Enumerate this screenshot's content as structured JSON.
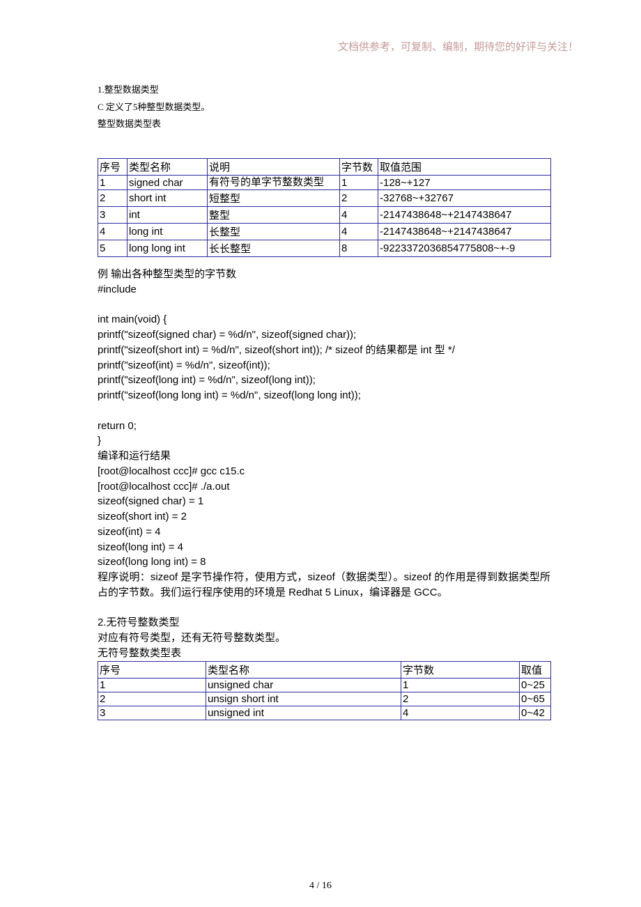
{
  "header_note": "文档供参考，可复制、编制，期待您的好评与关注！",
  "intro": {
    "l1": "1.整型数据类型",
    "l2": "C 定义了5种整型数据类型。",
    "l3": "整型数据类型表"
  },
  "table1": {
    "headers": [
      "序号",
      "类型名称",
      "说明",
      "字节数",
      "取值范围"
    ],
    "rows": [
      [
        "1",
        "signed char",
        "有符号的单字节整数类型",
        "1",
        "-128~+127"
      ],
      [
        "2",
        "short int",
        "短整型",
        "2",
        "-32768~+32767"
      ],
      [
        "3",
        "int",
        "整型",
        "4",
        "-2147438648~+2147438647"
      ],
      [
        "4",
        "long int",
        "长整型",
        "4",
        "-2147438648~+2147438647"
      ],
      [
        "5",
        "long long int",
        "长长整型",
        "8",
        "-9223372036854775808~+-9"
      ]
    ]
  },
  "code": {
    "l0": "例  输出各种整型类型的字节数",
    "l1": "#include",
    "l2": "int main(void) {",
    "l3": "printf(\"sizeof(signed char) = %d/n\", sizeof(signed char));",
    "l4": "printf(\"sizeof(short int) = %d/n\", sizeof(short int)); /* sizeof 的结果都是 int 型  */",
    "l5": "printf(\"sizeof(int) = %d/n\", sizeof(int));",
    "l6": "printf(\"sizeof(long int) = %d/n\", sizeof(long int));",
    "l7": "printf(\"sizeof(long long int) = %d/n\", sizeof(long long int));",
    "l8": "return 0;",
    "l9": "}",
    "r0": "编译和运行结果",
    "r1": "[root@localhost ccc]# gcc c15.c",
    "r2": "[root@localhost ccc]# ./a.out",
    "r3": "sizeof(signed char) = 1",
    "r4": "sizeof(short int) = 2",
    "r5": "sizeof(int) = 4",
    "r6": "sizeof(long int) = 4",
    "r7": "sizeof(long long int) = 8",
    "exp": "程序说明：sizeof 是字节操作符，使用方式，sizeof（数据类型）。sizeof 的作用是得到数据类型所占的字节数。我们运行程序使用的环境是 Redhat 5 Linux，编译器是 GCC。"
  },
  "sec2": {
    "l1": "2.无符号整数类型",
    "l2": "对应有符号类型，还有无符号整数类型。",
    "l3": "无符号整数类型表"
  },
  "table2": {
    "headers": [
      "序号",
      "类型名称",
      "字节数",
      "取值"
    ],
    "rows": [
      [
        "1",
        "unsigned char",
        "1",
        "0~25"
      ],
      [
        "2",
        "unsign short int",
        "2",
        "0~65"
      ],
      [
        "3",
        "unsigned int",
        "4",
        "0~42"
      ]
    ]
  },
  "page_number": "4  /  16"
}
